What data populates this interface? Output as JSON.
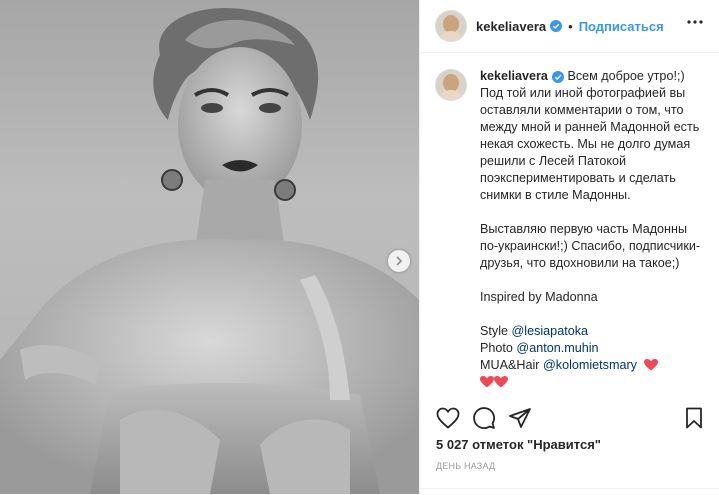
{
  "post": {
    "username": "kekeliavera",
    "follow_label": "Подписаться",
    "dot": "•",
    "caption": {
      "greeting": "Всем доброе утро!;)",
      "paragraph1": "Под той или иной фотографией вы оставляли комментарии о том, что между мной и ранней Мадонной есть некая схожесть. Мы не долго думая решили с Лесей Патокой поэкспериментировать и сделать снимки в стиле Мадонны.",
      "paragraph2": "Выставляю первую часть Мадонны по-украински!;) Спасибо, подписчики-друзья, что вдохновили на такое;)",
      "paragraph3": "Inspired by Madonna",
      "style_label": "Style ",
      "style_mention": "@lesiapatoka",
      "photo_label": "Photo ",
      "photo_mention": "@anton.muhin",
      "mua_label": "MUA&Hair ",
      "mua_mention": "@kolomietsmary"
    },
    "likes_text": "5 027 отметок \"Нравится\"",
    "time_text": "ДЕНЬ НАЗАД"
  },
  "icons": {
    "verified": "verified-badge-icon",
    "more": "more-options-icon",
    "like": "heart-icon",
    "comment": "comment-icon",
    "share": "share-icon",
    "save": "bookmark-icon",
    "next": "chevron-right-icon"
  },
  "colors": {
    "link": "#3897f0",
    "mention": "#003569",
    "heart": "#ed4956",
    "text": "#262626",
    "muted": "#999999"
  }
}
